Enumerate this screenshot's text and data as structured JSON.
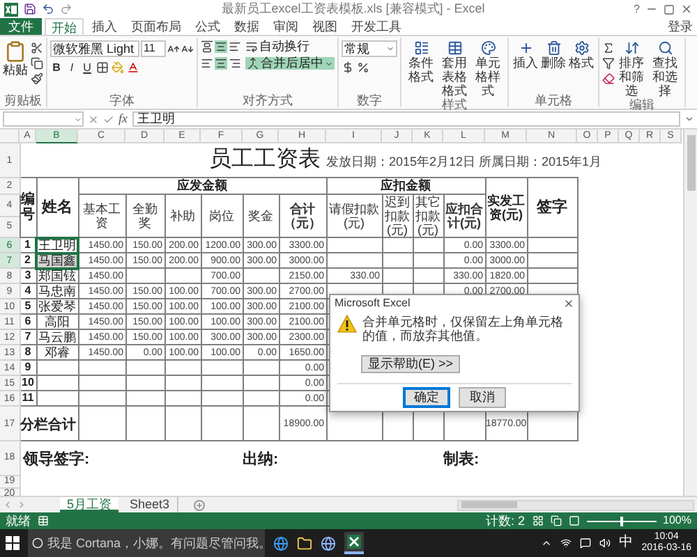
{
  "window": {
    "title": "最新员工excel工资表模板.xls [兼容模式] - Excel",
    "help": "?"
  },
  "ribbon_tabs": [
    {
      "label": "文件",
      "kind": "file",
      "selected": false
    },
    {
      "label": "开始",
      "kind": "tab",
      "selected": true
    },
    {
      "label": "插入",
      "kind": "tab",
      "selected": false
    },
    {
      "label": "页面布局",
      "kind": "tab",
      "selected": false
    },
    {
      "label": "公式",
      "kind": "tab",
      "selected": false
    },
    {
      "label": "数据",
      "kind": "tab",
      "selected": false
    },
    {
      "label": "审阅",
      "kind": "tab",
      "selected": false
    },
    {
      "label": "视图",
      "kind": "tab",
      "selected": false
    },
    {
      "label": "开发工具",
      "kind": "tab",
      "selected": false
    }
  ],
  "account": "登录",
  "ribbon_groups": [
    {
      "kind": "clipboard",
      "label": "剪贴板",
      "paste": "粘贴"
    },
    {
      "kind": "font",
      "label": "字体",
      "font_name": "微软雅黑 Light",
      "font_size": "11",
      "styles": [
        "B",
        "I",
        "U"
      ]
    },
    {
      "kind": "alignment",
      "label": "对齐方式",
      "wrap": "自动换行",
      "merge": "合并后居中",
      "merge_selected": true
    },
    {
      "kind": "number",
      "label": "数字",
      "format": "常规"
    },
    {
      "kind": "styles",
      "label": "样式",
      "buttons": [
        "条件格式",
        "套用表格格式",
        "单元格样式"
      ]
    },
    {
      "kind": "cells",
      "label": "单元格",
      "buttons": [
        "插入",
        "删除",
        "格式"
      ]
    },
    {
      "kind": "editing",
      "label": "编辑",
      "buttons": [
        "排序和筛选",
        "查找和选择"
      ]
    }
  ],
  "formula_bar": {
    "fx": "fx",
    "value": "王卫明"
  },
  "columns": [
    {
      "label": "A",
      "selected": false
    },
    {
      "label": "B",
      "selected": true
    },
    {
      "label": "C",
      "selected": false
    },
    {
      "label": "D",
      "selected": false
    },
    {
      "label": "E",
      "selected": false
    },
    {
      "label": "F",
      "selected": false
    },
    {
      "label": "G",
      "selected": false
    },
    {
      "label": "H",
      "selected": false
    },
    {
      "label": "I",
      "selected": false
    },
    {
      "label": "J",
      "selected": false
    },
    {
      "label": "K",
      "selected": false
    },
    {
      "label": "L",
      "selected": false
    },
    {
      "label": "M",
      "selected": false
    },
    {
      "label": "N",
      "selected": false
    },
    {
      "label": "O",
      "selected": false
    },
    {
      "label": "P",
      "selected": false
    },
    {
      "label": "Q",
      "selected": false
    },
    {
      "label": "R",
      "selected": false
    },
    {
      "label": "S",
      "selected": false
    }
  ],
  "sheet": {
    "title": "员工工资表",
    "dates": "发放日期：2015年2月12日 所属日期：2015年1月",
    "header_rows": [
      "1",
      "2",
      "4",
      "5"
    ],
    "no_header": "编号",
    "name_header": "姓名",
    "payable_header": "应发金额",
    "deduction_header": "应扣金额",
    "net_header": "实发工资(元)",
    "sign_header": "签字",
    "sub_headers": [
      "基本工资",
      "全勤奖",
      "补助",
      "岗位",
      "奖金",
      "合计（元）",
      "请假扣款(元)",
      "迟到扣款(元)",
      "其它扣款(元)",
      "应扣合计(元)"
    ]
  },
  "rows": [
    {
      "row_header": "6",
      "no": "1",
      "name": "王卫明",
      "selected": true,
      "active": true,
      "cells": [
        "1450.00",
        "150.00",
        "200.00",
        "1200.00",
        "300.00",
        "3300.00",
        null,
        null,
        null,
        "0.00",
        "3300.00"
      ]
    },
    {
      "row_header": "7",
      "no": "2",
      "name": "马国鑫",
      "selected": true,
      "active": false,
      "cells": [
        "1450.00",
        "150.00",
        "200.00",
        "900.00",
        "300.00",
        "3000.00",
        null,
        null,
        null,
        "0.00",
        "3000.00"
      ]
    },
    {
      "row_header": "8",
      "no": "3",
      "name": "郑国铉",
      "selected": false,
      "cells": [
        "1450.00",
        null,
        null,
        "700.00",
        null,
        "2150.00",
        "330.00",
        null,
        null,
        "330.00",
        "1820.00"
      ]
    },
    {
      "row_header": "9",
      "no": "4",
      "name": "马忠南",
      "selected": false,
      "cells": [
        "1450.00",
        "150.00",
        "100.00",
        "700.00",
        "300.00",
        "2700.00",
        null,
        null,
        null,
        "0.00",
        "2700.00"
      ]
    },
    {
      "row_header": "10",
      "no": "5",
      "name": "张爱琴",
      "selected": false,
      "cells": [
        "1450.00",
        "150.00",
        "100.00",
        "100.00",
        "300.00",
        "2100.00"
      ]
    },
    {
      "row_header": "11",
      "no": "6",
      "name": "高阳",
      "selected": false,
      "cells": [
        "1450.00",
        "150.00",
        "100.00",
        "100.00",
        "300.00",
        "2100.00"
      ]
    },
    {
      "row_header": "12",
      "no": "7",
      "name": "马云鹏",
      "selected": false,
      "cells": [
        "1450.00",
        "150.00",
        "100.00",
        "300.00",
        "300.00",
        "2300.00"
      ]
    },
    {
      "row_header": "13",
      "no": "8",
      "name": "邓睿",
      "selected": false,
      "cells": [
        "1450.00",
        "0.00",
        "100.00",
        "100.00",
        "0.00",
        "1650.00"
      ]
    },
    {
      "row_header": "14",
      "no": "9",
      "selected": false,
      "cells": [
        null,
        null,
        null,
        null,
        null,
        "0.00"
      ]
    },
    {
      "row_header": "15",
      "no": "10",
      "selected": false,
      "cells": [
        null,
        null,
        null,
        null,
        null,
        "0.00"
      ]
    },
    {
      "row_header": "16",
      "no": "11",
      "selected": false,
      "cells": [
        null,
        null,
        null,
        null,
        null,
        "0.00"
      ]
    }
  ],
  "total_row": {
    "row_header": "17",
    "label": "分栏合计",
    "total": "18900.00",
    "net": "18770.00"
  },
  "footer_row": {
    "row_header": "18",
    "labels": [
      "领导签字:",
      "出纳:",
      "制表:"
    ]
  },
  "empty_rows": [
    "19",
    "20"
  ],
  "dialog": {
    "title": "Microsoft Excel",
    "message": "合并单元格时，仅保留左上角单元格的值，而放弃其他值。",
    "help_button": "显示帮助(E) >>",
    "buttons": [
      {
        "label": "确定",
        "default": true
      },
      {
        "label": "取消",
        "default": false
      }
    ]
  },
  "sheet_tabs": [
    {
      "label": "5月工资",
      "selected": true
    },
    {
      "label": "Sheet3",
      "selected": false
    }
  ],
  "status_bar": {
    "status": "就绪",
    "count": "计数: 2",
    "zoom": {
      "level": 0.5,
      "reading": "100%"
    }
  },
  "taskbar": {
    "search_placeholder": "我是 Cortana，小娜。有问题尽管问我。",
    "ime": "中",
    "time": "10:04",
    "date": "2016-03-16"
  }
}
